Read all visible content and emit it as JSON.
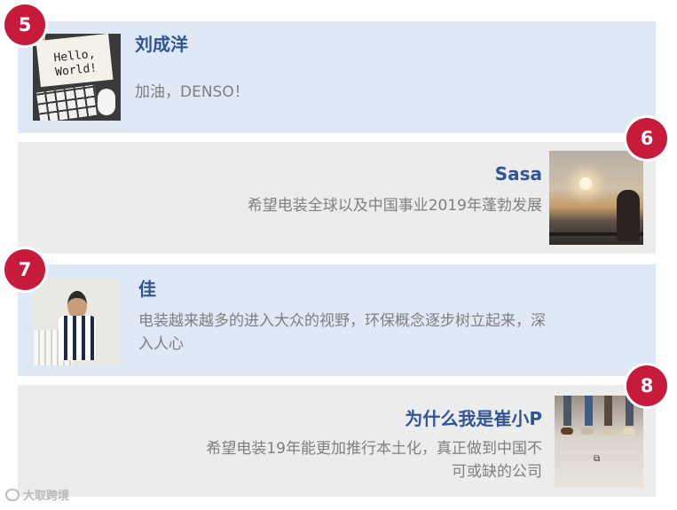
{
  "cards": [
    {
      "number": "5",
      "name": "刘成洋",
      "message": "加油，DENSO！",
      "photo": {
        "paper_text": "Hello,\nWorld!"
      }
    },
    {
      "number": "6",
      "name": "Sasa",
      "message": "希望电装全球以及中国事业2019年蓬勃发展"
    },
    {
      "number": "7",
      "name": "佳",
      "message_line1": "电装越来越多的进入大众的视野，环保概念逐步树立起来，深",
      "message_line2": "入人心"
    },
    {
      "number": "8",
      "name": "为什么我是崔小P",
      "message_line1": "希望电装19年能更加推行本土化，真正做到中国不",
      "message_line2": "可或缺的公司"
    }
  ],
  "watermark": "大取跨境",
  "colors": {
    "badge": "#c81b3b",
    "name": "#2f5597",
    "message": "#7f7f7f",
    "card_blue": "#dfe8f5",
    "card_gray": "#ececec"
  }
}
